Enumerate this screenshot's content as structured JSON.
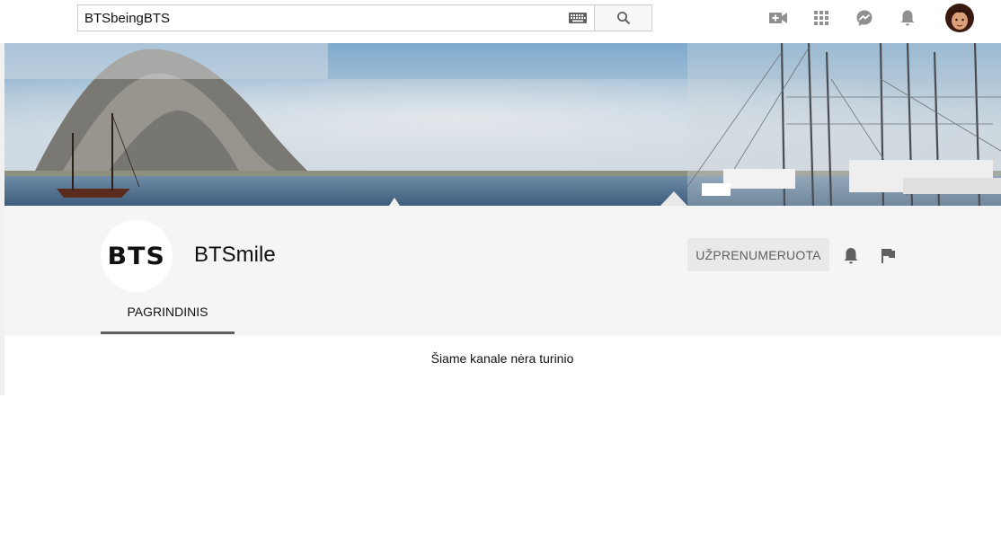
{
  "search": {
    "query": "BTSbeingBTS",
    "keyboard_icon": "keyboard-icon",
    "search_icon": "search-icon"
  },
  "topbar": {
    "icons": [
      "video-camera-add-icon",
      "apps-grid-icon",
      "messages-icon",
      "notifications-bell-icon",
      "account-avatar"
    ]
  },
  "channel": {
    "name": "BTSmile",
    "logo_text": "BTS",
    "subscribe_label": "UŽPRENUMERUOTA",
    "tab_home": "PAGRINDINIS"
  },
  "content": {
    "empty_message": "Šiame kanale nėra turinio"
  },
  "colors": {
    "header_bg": "#f5f5f5",
    "icon_gray": "#909090",
    "tab_underline": "#606060"
  }
}
